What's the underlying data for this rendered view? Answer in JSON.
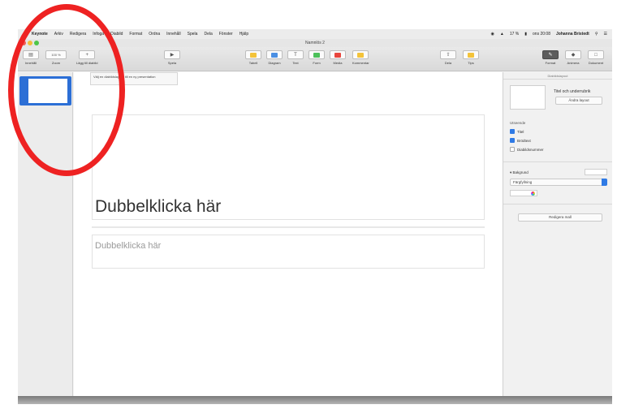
{
  "menubar": {
    "apple": "",
    "app_name": "Keynote",
    "items": [
      "Arkiv",
      "Redigera",
      "Infoga",
      "Diabild",
      "Format",
      "Ordna",
      "Innehåll",
      "Spela",
      "Dela",
      "Fönster",
      "Hjälp"
    ],
    "status": [
      "17 %",
      "ons 20:08",
      "Johanna Bristedt"
    ]
  },
  "window": {
    "title": "Namnlös 2"
  },
  "toolbar": {
    "view_label": "Innehåll",
    "zoom_label": "Zoom",
    "zoom_value": "100 %",
    "add_slide_label": "Lägg till diabild",
    "play_label": "Spela",
    "table_label": "Tabell",
    "chart_label": "Diagram",
    "text_label": "Text",
    "shape_label": "Form",
    "media_label": "Media",
    "comment_label": "Kommentar",
    "share_label": "Dela",
    "tips_label": "Tips",
    "format_label": "Format",
    "animate_label": "Animera",
    "document_label": "Dokument"
  },
  "canvas": {
    "tooltip": "Välj en diabildslayout till en ny presentation",
    "title_placeholder": "Dubbelklicka här",
    "body_placeholder": "Dubbelklicka här"
  },
  "inspector": {
    "header": "Diabildslayout",
    "layout_name": "Titel och underrubrik",
    "change_layout": "Ändra layout",
    "appearance_title": "Utseende",
    "checkboxes": [
      {
        "label": "Titel",
        "checked": true
      },
      {
        "label": "Brödtext",
        "checked": true
      },
      {
        "label": "Diabildsnummer",
        "checked": false
      }
    ],
    "background_label": "Bakgrund",
    "fill_option": "Färgfyllning",
    "edit_master": "Redigera mall"
  },
  "colors": {
    "accent": "#2f7ae5",
    "annotation": "#ee2222",
    "selection": "#2c6fd6"
  }
}
